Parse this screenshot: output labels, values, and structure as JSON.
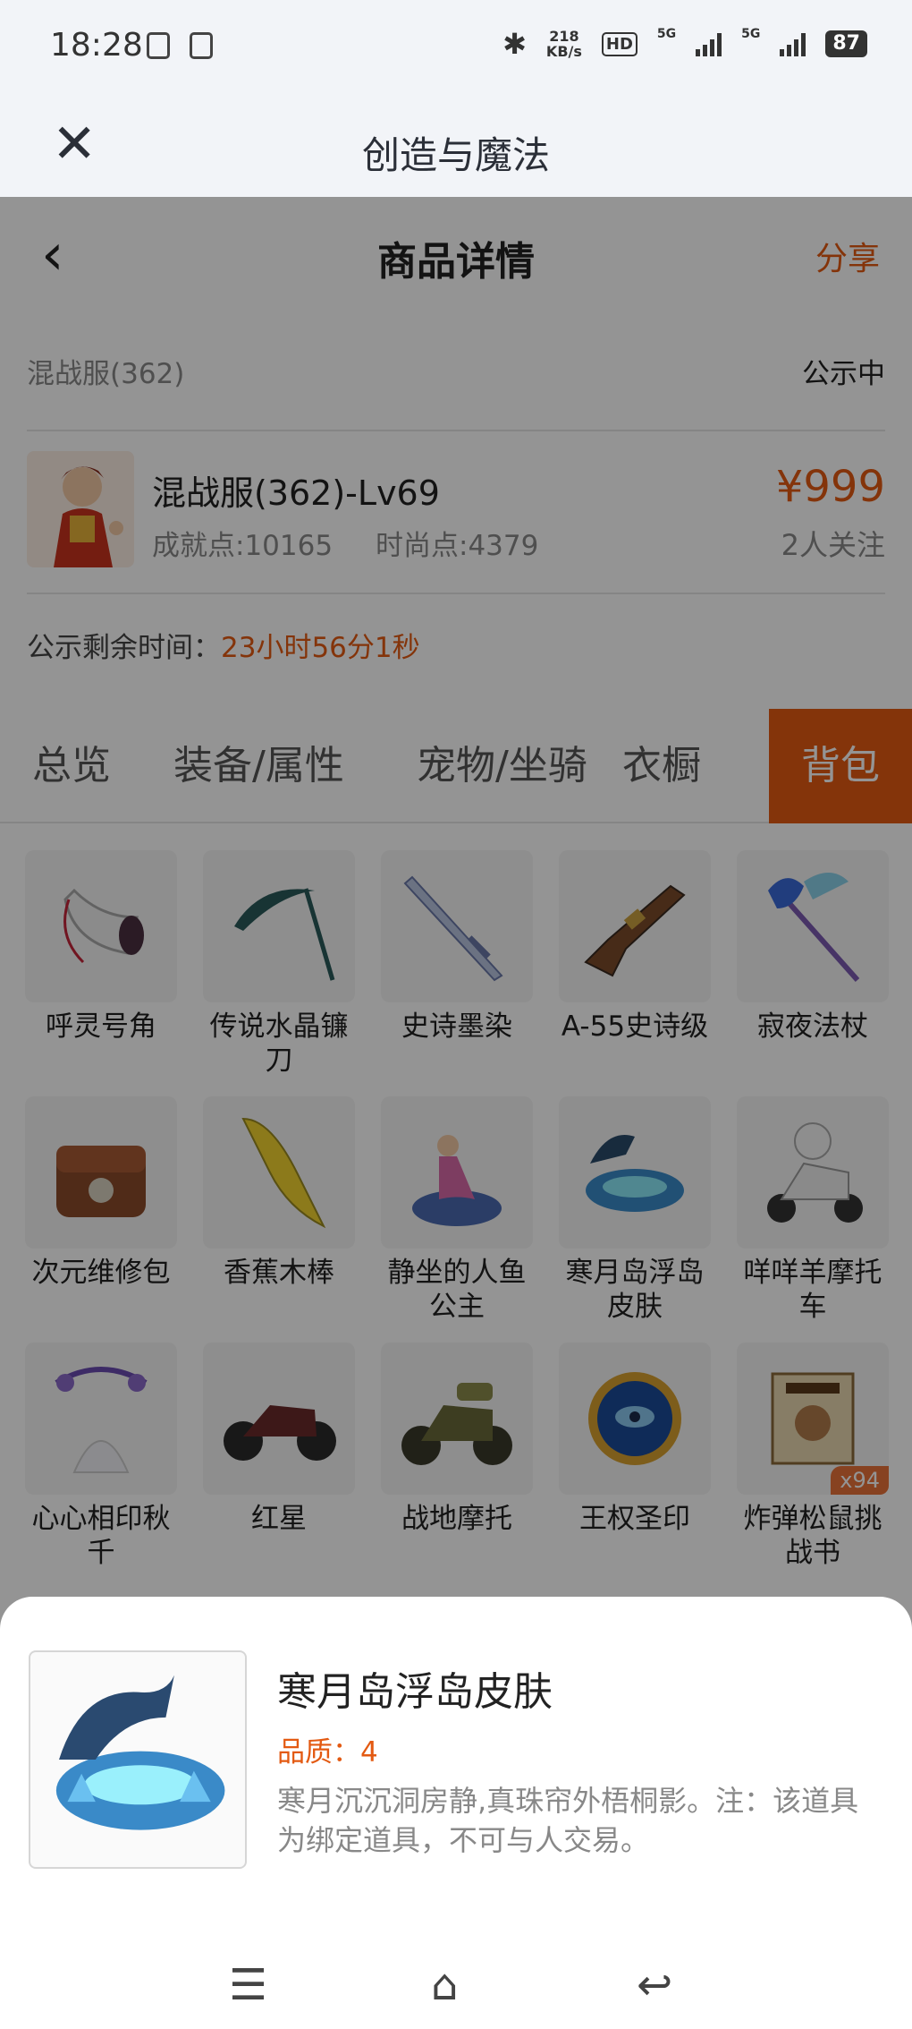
{
  "status_bar": {
    "time": "18:28",
    "speed_value": "218",
    "speed_unit": "KB/s",
    "hd": "HD",
    "net1": "5G",
    "net2": "5G",
    "battery": "87"
  },
  "topbar": {
    "title": "创造与魔法"
  },
  "header": {
    "title": "商品详情",
    "share": "分享"
  },
  "server": {
    "name": "混战服(362)",
    "status": "公示中"
  },
  "product": {
    "name": "混战服(362)-Lv69",
    "achievement": "成就点:10165",
    "fashion": "时尚点:4379",
    "price": "¥999",
    "followers": "2人关注"
  },
  "timer": {
    "label": "公示剩余时间：",
    "value": "23小时56分1秒"
  },
  "tabs": [
    "总览",
    "装备/属性",
    "宠物/坐骑",
    "衣橱",
    "背包"
  ],
  "active_tab": "背包",
  "items": [
    {
      "name": "呼灵号角",
      "icon": "horn-icon"
    },
    {
      "name": "传说水晶镰刀",
      "icon": "scythe-icon"
    },
    {
      "name": "史诗墨染",
      "icon": "sword-icon"
    },
    {
      "name": "A-55史诗级",
      "icon": "rifle-icon"
    },
    {
      "name": "寂夜法杖",
      "icon": "staff-icon"
    },
    {
      "name": "次元维修包",
      "icon": "bag-icon"
    },
    {
      "name": "香蕉木棒",
      "icon": "banana-icon"
    },
    {
      "name": "静坐的人鱼公主",
      "icon": "mermaid-icon"
    },
    {
      "name": "寒月岛浮岛皮肤",
      "icon": "island-icon"
    },
    {
      "name": "咩咩羊摩托车",
      "icon": "scooter-icon"
    },
    {
      "name": "心心相印秋千",
      "icon": "swing-icon"
    },
    {
      "name": "红星",
      "icon": "motorbike-icon"
    },
    {
      "name": "战地摩托",
      "icon": "war-motorbike-icon"
    },
    {
      "name": "王权圣印",
      "icon": "seal-icon"
    },
    {
      "name": "炸弹松鼠挑战书",
      "icon": "scroll-icon",
      "badge": "x94"
    }
  ],
  "sheet": {
    "name": "寒月岛浮岛皮肤",
    "quality": "品质：4",
    "desc": "寒月沉沉洞房静,真珠帘外梧桐影。注：该道具为绑定道具，不可与人交易。"
  }
}
